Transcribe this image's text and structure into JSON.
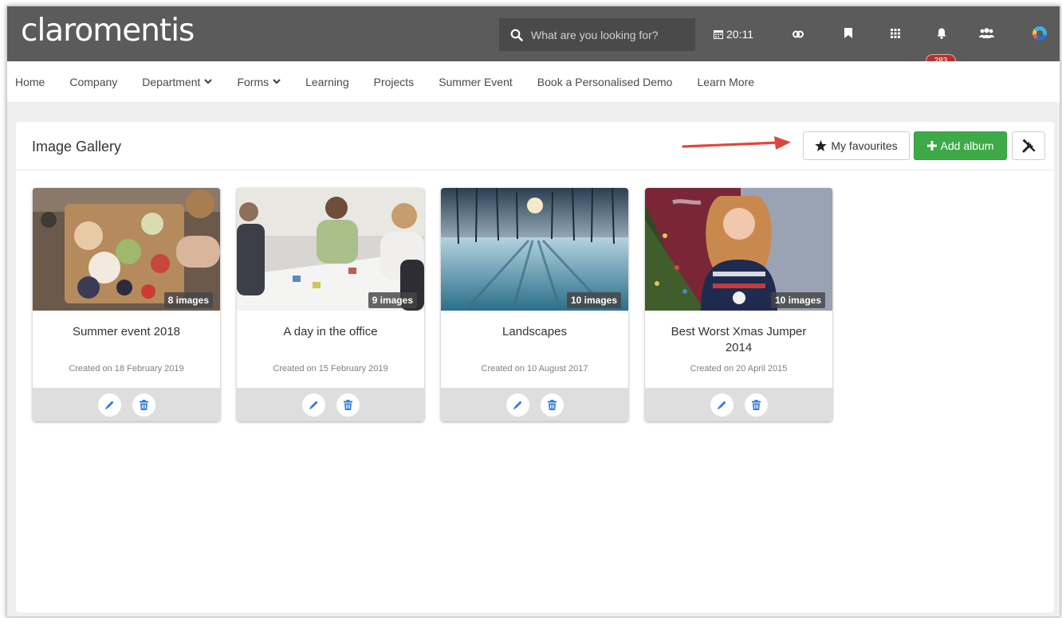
{
  "app": {
    "logo": "claromentis",
    "search_placeholder": "What are you looking for?",
    "time": "20:11",
    "notification_count": "283"
  },
  "nav": {
    "items": [
      {
        "label": "Home"
      },
      {
        "label": "Company"
      },
      {
        "label": "Department",
        "dropdown": true
      },
      {
        "label": "Forms",
        "dropdown": true
      },
      {
        "label": "Learning"
      },
      {
        "label": "Projects"
      },
      {
        "label": "Summer Event"
      },
      {
        "label": "Book a Personalised Demo"
      },
      {
        "label": "Learn More"
      }
    ]
  },
  "panel": {
    "title": "Image Gallery",
    "favourites_label": "My favourites",
    "add_album_label": "Add album"
  },
  "albums": [
    {
      "name": "Summer event 2018",
      "count": "8 images",
      "created": "Created on 18 February 2019"
    },
    {
      "name": "A day in the office",
      "count": "9 images",
      "created": "Created on 15 February 2019"
    },
    {
      "name": "Landscapes",
      "count": "10 images",
      "created": "Created on 10 August 2017"
    },
    {
      "name": "Best Worst Xmas Jumper 2014",
      "count": "10 images",
      "created": "Created on 20 April 2015"
    }
  ],
  "colors": {
    "topbar": "#5b5b5b",
    "accent_green": "#3daa47",
    "badge_red": "#b5332c",
    "action_blue": "#2f7ed8",
    "annotation_arrow": "#e0473c"
  },
  "icons": {
    "search": "search-icon",
    "calendar": "calendar-icon",
    "link": "link-icon",
    "bookmark": "bookmark-icon",
    "apps": "apps-grid-icon",
    "bell": "bell-icon",
    "people": "people-icon",
    "star": "star-icon",
    "plus": "plus-icon",
    "tools": "tools-icon",
    "edit": "pencil-icon",
    "delete": "trash-icon"
  }
}
